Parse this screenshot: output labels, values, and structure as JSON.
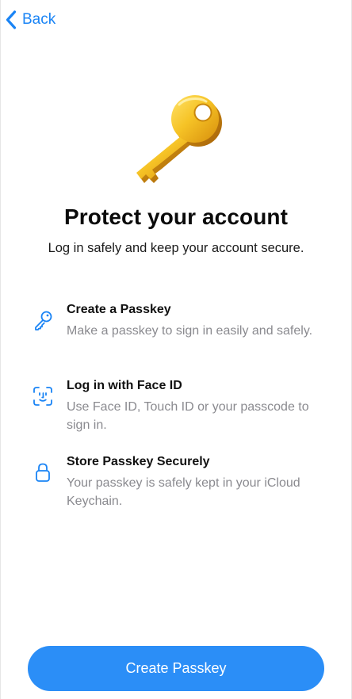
{
  "nav": {
    "back_label": "Back",
    "back_icon": "chevron-left-icon"
  },
  "hero": {
    "icon": "key-icon"
  },
  "header": {
    "title": "Protect your account",
    "subtitle": "Log in safely and keep your account secure."
  },
  "features": [
    {
      "icon": "key-outline-icon",
      "title": "Create a Passkey",
      "description": "Make a passkey to sign in easily and safely."
    },
    {
      "icon": "face-id-icon",
      "title": "Log in with Face ID",
      "description": "Use Face ID, Touch ID or your passcode to sign in."
    },
    {
      "icon": "lock-icon",
      "title": "Store Passkey Securely",
      "description": "Your passkey is safely kept in your iCloud Keychain."
    }
  ],
  "primary_button": {
    "label": "Create Passkey"
  },
  "colors": {
    "accent": "#1a84f5",
    "button": "#2b8ef7",
    "key_gold": "#f2b51f",
    "secondary_text": "#8a8a8f"
  }
}
